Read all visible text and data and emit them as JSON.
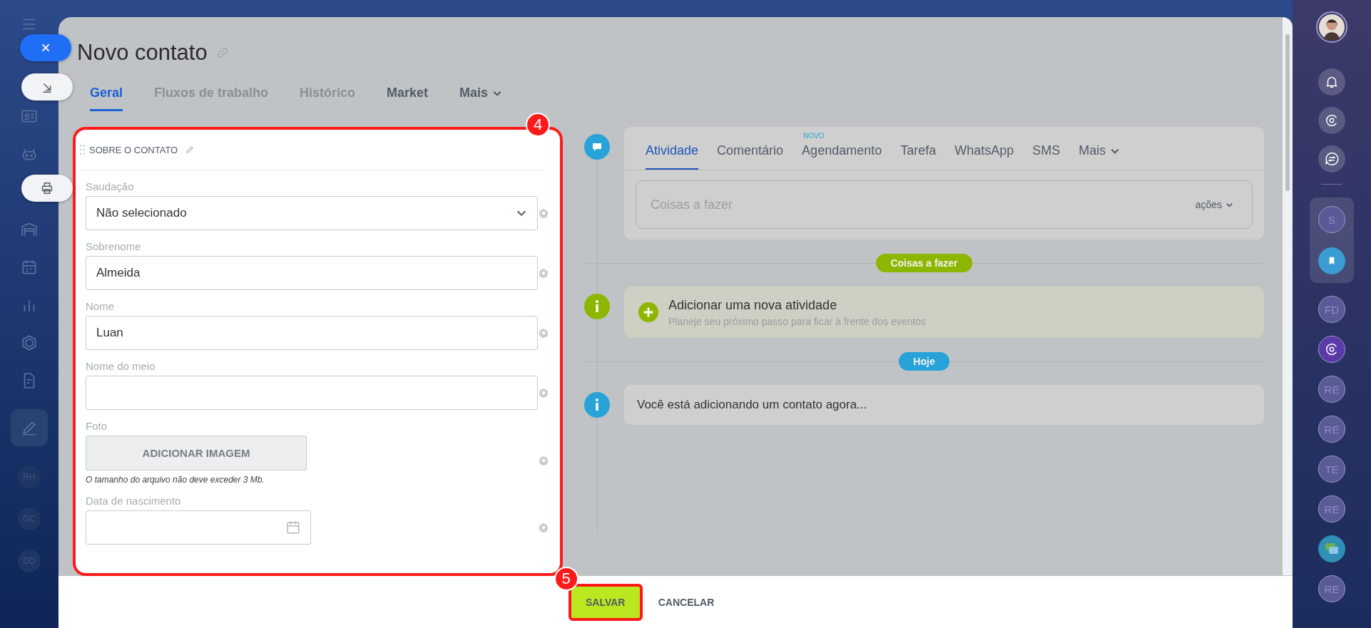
{
  "left_sidebar": {
    "avatars": [
      "RH",
      "GC",
      "DD"
    ]
  },
  "header": {
    "title": "Novo contato"
  },
  "tabs": [
    {
      "label": "Geral",
      "selected": true,
      "disabled": false,
      "menu": false
    },
    {
      "label": "Fluxos de trabalho",
      "selected": false,
      "disabled": true,
      "menu": false
    },
    {
      "label": "Histórico",
      "selected": false,
      "disabled": true,
      "menu": false
    },
    {
      "label": "Market",
      "selected": false,
      "disabled": false,
      "menu": false
    },
    {
      "label": "Mais",
      "selected": false,
      "disabled": false,
      "menu": true
    }
  ],
  "form": {
    "section_title": "SOBRE O CONTATO",
    "callout": "4",
    "fields": [
      {
        "kind": "select",
        "label": "Saudação",
        "value": "Não selecionado"
      },
      {
        "kind": "text",
        "label": "Sobrenome",
        "value": "Almeida"
      },
      {
        "kind": "text",
        "label": "Nome",
        "value": "Luan"
      },
      {
        "kind": "text",
        "label": "Nome do meio"
      },
      {
        "kind": "image",
        "label": "Foto",
        "button": "ADICIONAR IMAGEM",
        "hint": "O tamanho do arquivo não deve exceder 3 Mb."
      },
      {
        "kind": "date",
        "label": "Data de nascimento"
      }
    ]
  },
  "timeline": {
    "tabs": [
      {
        "label": "Atividade",
        "selected": true,
        "menu": false
      },
      {
        "label": "Comentário",
        "selected": false,
        "menu": false
      },
      {
        "label": "Agendamento",
        "selected": false,
        "menu": false,
        "badge": "NOVO"
      },
      {
        "label": "Tarefa",
        "selected": false,
        "menu": false
      },
      {
        "label": "WhatsApp",
        "selected": false,
        "menu": false
      },
      {
        "label": "SMS",
        "selected": false,
        "menu": false
      },
      {
        "label": "Mais",
        "selected": false,
        "menu": true
      }
    ],
    "placeholder": "Coisas a fazer",
    "actions": "ações",
    "todo_divider": "Coisas a fazer",
    "add_activity": {
      "title": "Adicionar uma nova atividade",
      "subtitle": "Planeje seu próximo passo para ficar à frente dos eventos"
    },
    "today_divider": "Hoje",
    "event": "Você está adicionando um contato agora..."
  },
  "footer": {
    "save": "SALVAR",
    "cancel": "CANCELAR",
    "callout": "5"
  },
  "right_bar": {
    "items": [
      {
        "kind": "initials",
        "text": "S",
        "pinned": true
      },
      {
        "kind": "bookmark",
        "pinned": true
      },
      {
        "kind": "initials",
        "text": "FD",
        "pinned": false
      },
      {
        "kind": "copilot",
        "pinned": false
      },
      {
        "kind": "initials",
        "text": "RE",
        "pinned": false
      },
      {
        "kind": "initials",
        "text": "RE",
        "pinned": false
      },
      {
        "kind": "initials",
        "text": "TE",
        "pinned": false
      },
      {
        "kind": "initials",
        "text": "RE",
        "pinned": false
      },
      {
        "kind": "chat",
        "pinned": false
      },
      {
        "kind": "initials",
        "text": "RE",
        "pinned": false
      }
    ]
  }
}
